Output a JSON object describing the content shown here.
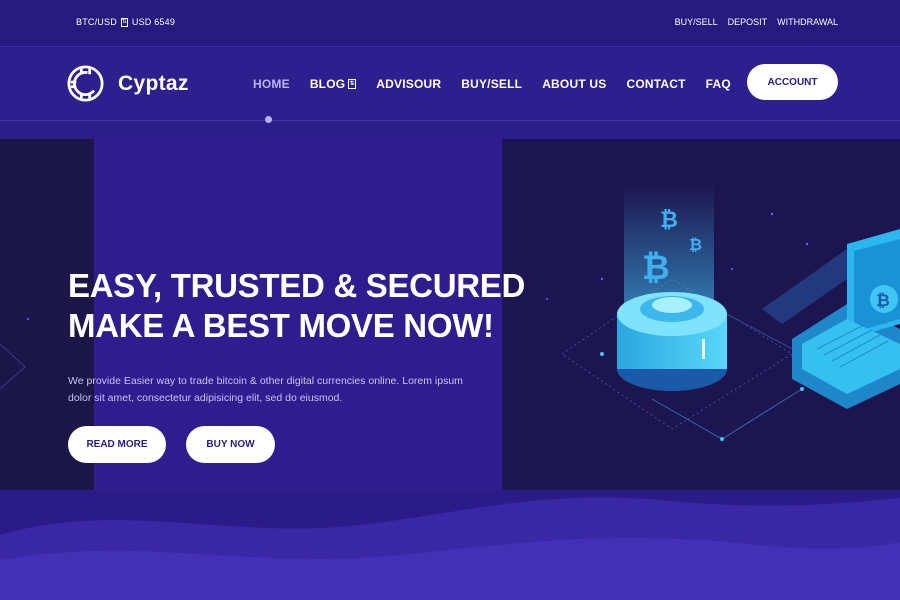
{
  "topbar": {
    "ticker_pair": "BTC/USD",
    "ticker_value": "USD 6549",
    "ticker_icon": "updown-arrow-icon",
    "links": [
      "BUY/SELL",
      "DEPOSIT",
      "WITHDRAWAL"
    ]
  },
  "header": {
    "brand": "Cyptaz",
    "nav": [
      {
        "label": "HOME",
        "active": true
      },
      {
        "label": "BLOG",
        "active": false
      },
      {
        "label": "ADVISOUR",
        "active": false
      },
      {
        "label": "BUY/SELL",
        "active": false
      },
      {
        "label": "ABOUT US",
        "active": false
      },
      {
        "label": "CONTACT",
        "active": false
      },
      {
        "label": "FAQ",
        "active": false
      }
    ],
    "account_label": "ACCOUNT"
  },
  "hero": {
    "headline_line1": "EASY, TRUSTED & SECURED",
    "headline_line2": "MAKE A BEST MOVE NOW!",
    "description": "We provide Easier way to trade bitcoin & other digital currencies online. Lorem ipsum dolor sit amet, consectetur adipisicing elit, sed do eiusmod.",
    "read_more_label": "READ MORE",
    "buy_now_label": "BUY NOW",
    "illustration": "bitcoin-server-laptop-illustration"
  },
  "colors": {
    "background": "#2d1d8a",
    "topbar": "#261a7e",
    "panel_dark": "#1d1550",
    "accent_cyan": "#3fc6f5",
    "button_text": "#2a1a86",
    "nav_active": "#b8b5f5"
  }
}
